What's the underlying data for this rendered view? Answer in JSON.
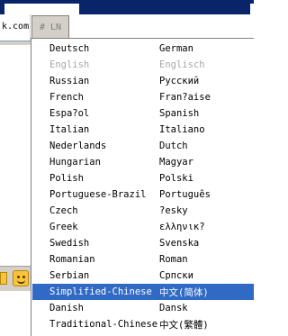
{
  "background": {
    "url_fragment": "k.com"
  },
  "toolbar": {
    "lang_button_label": "# LN"
  },
  "menu": {
    "items": [
      {
        "label": "Deutsch",
        "native": "German",
        "state": "normal"
      },
      {
        "label": "English",
        "native": "Englisch",
        "state": "disabled"
      },
      {
        "label": "Russian",
        "native": "Русский",
        "state": "normal"
      },
      {
        "label": "French",
        "native": "Fran?aise",
        "state": "normal"
      },
      {
        "label": "Espa?ol",
        "native": "Spanish",
        "state": "normal"
      },
      {
        "label": "Italian",
        "native": "Italiano",
        "state": "normal"
      },
      {
        "label": "Nederlands",
        "native": "Dutch",
        "state": "normal"
      },
      {
        "label": "Hungarian",
        "native": "Magyar",
        "state": "normal"
      },
      {
        "label": "Polish",
        "native": "Polski",
        "state": "normal"
      },
      {
        "label": "Portuguese-Brazil",
        "native": "Português",
        "state": "normal"
      },
      {
        "label": "Czech",
        "native": "?esky",
        "state": "normal"
      },
      {
        "label": "Greek",
        "native": "ελληνικ?",
        "state": "normal"
      },
      {
        "label": "Swedish",
        "native": "Svenska",
        "state": "normal"
      },
      {
        "label": "Romanian",
        "native": "Roman",
        "state": "normal"
      },
      {
        "label": "Serbian",
        "native": "Српски",
        "state": "normal"
      },
      {
        "label": "Simplified-Chinese",
        "native": "中文(简体)",
        "state": "selected"
      },
      {
        "label": "Danish",
        "native": "Dansk",
        "state": "normal"
      },
      {
        "label": "Traditional-Chinese",
        "native": "中文(繁體)",
        "state": "normal"
      }
    ]
  },
  "colors": {
    "selection": "#316ac5",
    "disabled_text": "#a8a8a8",
    "title_bar": "#0a246a"
  }
}
